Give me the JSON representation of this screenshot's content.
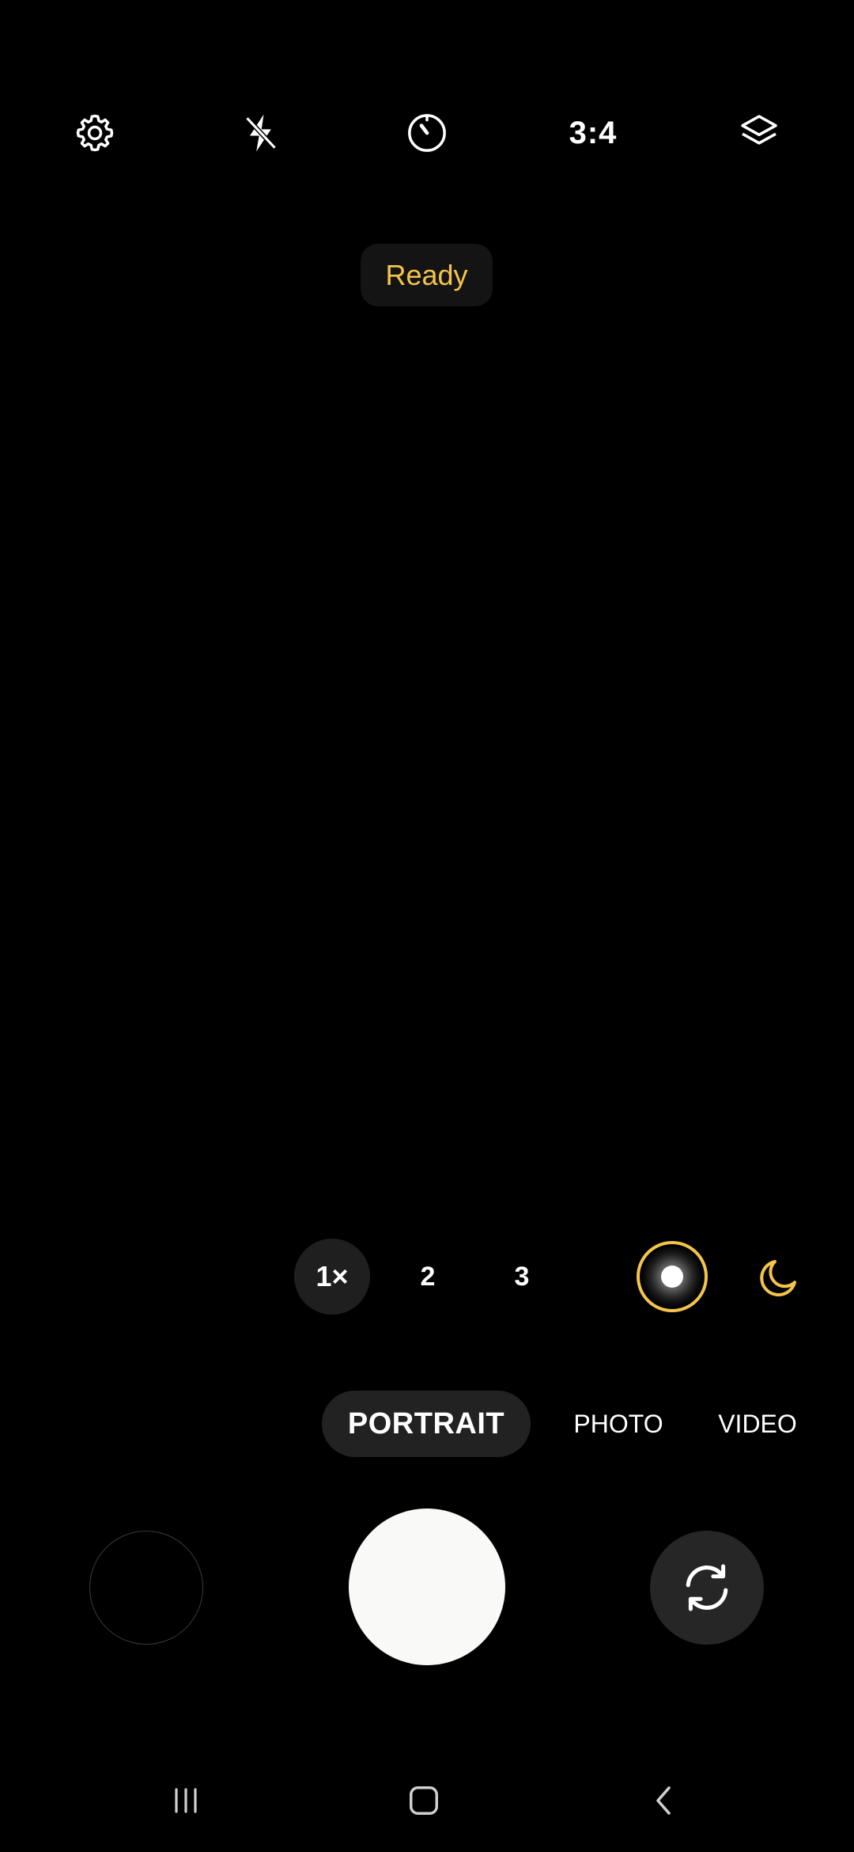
{
  "top_bar": {
    "settings_icon": "gear-icon",
    "flash_icon": "flash-off-icon",
    "timer_icon": "timer-icon",
    "aspect_ratio": "3:4",
    "filters_icon": "layers-icon"
  },
  "status": {
    "ready_label": "Ready"
  },
  "zoom": {
    "options": [
      "1×",
      "2",
      "3"
    ],
    "selected": "1×"
  },
  "modes": {
    "active": "PORTRAIT",
    "others": [
      "PHOTO",
      "VIDEO"
    ]
  },
  "controls": {
    "portrait_effect_icon": "portrait-effect-icon",
    "night_icon": "moon-icon",
    "flip_icon": "camera-flip-icon"
  },
  "nav": {
    "recents_icon": "recents-icon",
    "home_icon": "home-icon",
    "back_icon": "back-icon"
  },
  "colors": {
    "accent": "#f4c54b",
    "background": "#000000",
    "shutter": "#f9f9f7"
  }
}
